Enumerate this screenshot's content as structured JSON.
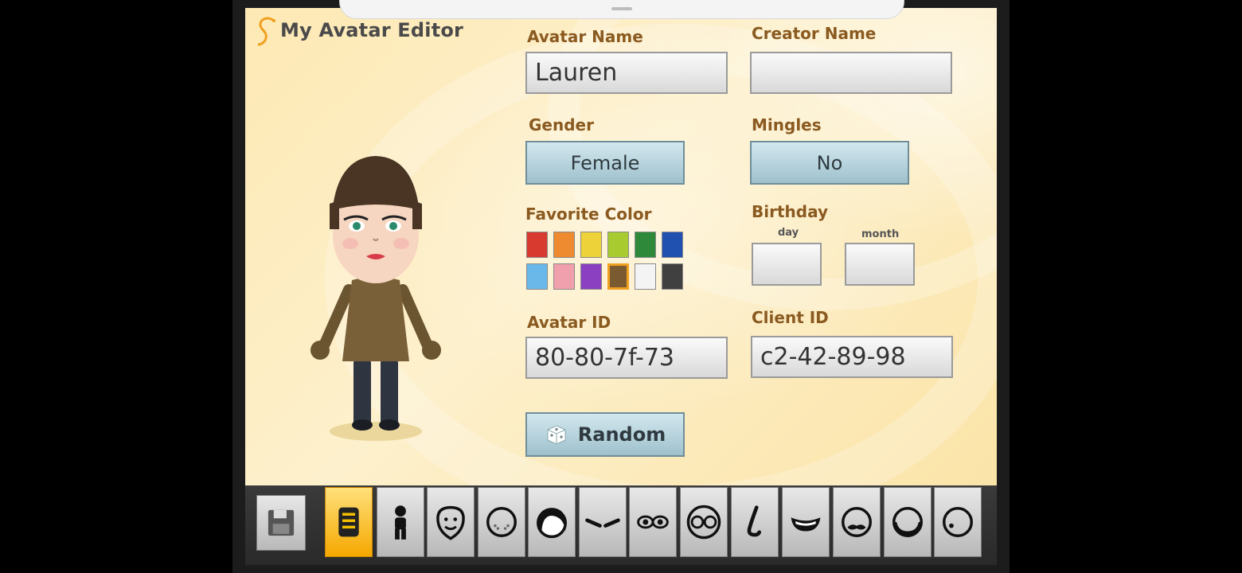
{
  "app": {
    "title": "My Avatar Editor"
  },
  "fields": {
    "avatar_name": {
      "label": "Avatar Name",
      "value": "Lauren"
    },
    "creator_name": {
      "label": "Creator Name",
      "value": ""
    },
    "gender": {
      "label": "Gender",
      "value": "Female"
    },
    "mingles": {
      "label": "Mingles",
      "value": "No"
    },
    "favorite_color": {
      "label": "Favorite Color",
      "colors": [
        "#d93a30",
        "#ee8a30",
        "#eed23a",
        "#a8cc30",
        "#2e8a3a",
        "#2050b0",
        "#6ab8ea",
        "#f0a0ac",
        "#8a40c0",
        "#7a5a30",
        "#f4f4f4",
        "#404040"
      ],
      "selected": "#7a5a30"
    },
    "birthday": {
      "label": "Birthday",
      "day_label": "day",
      "month_label": "month",
      "day": "",
      "month": ""
    },
    "avatar_id": {
      "label": "Avatar ID",
      "value": "80-80-7f-73"
    },
    "client_id": {
      "label": "Client ID",
      "value": "c2-42-89-98"
    },
    "random_button": {
      "label": "Random"
    }
  },
  "toolbar": {
    "items": [
      "save-icon",
      "general-info-icon",
      "body-icon",
      "face-shape-icon",
      "face-features-icon",
      "hair-icon",
      "eyebrows-icon",
      "eyes-icon",
      "glasses-icon",
      "nose-icon",
      "mouth-icon",
      "mustache-icon",
      "beard-icon",
      "mole-icon"
    ],
    "active": "general-info-icon"
  }
}
